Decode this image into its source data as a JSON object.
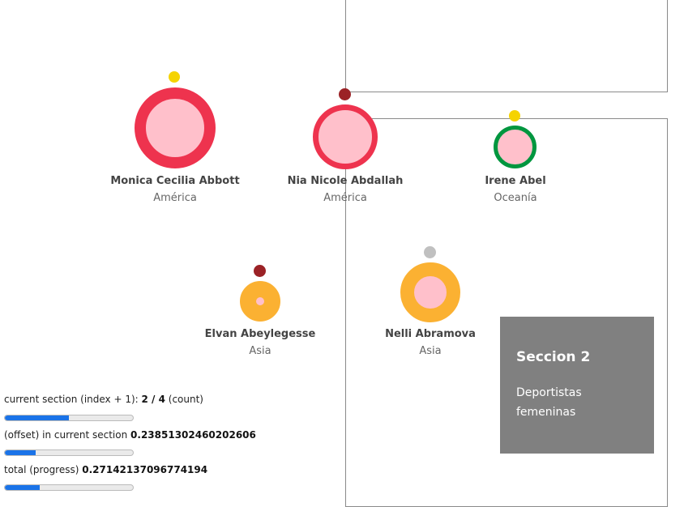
{
  "colors": {
    "america_ring": "#ee334e",
    "oceania_ring": "#00963f",
    "asia_ring": "#fbb132",
    "inner": "#ffc0cb",
    "medal_gold": "#f5d300",
    "medal_dark_red": "#9b2226",
    "medal_silver": "#c0c0c0",
    "panel_bg": "#808080",
    "progress_fill": "#1a73e8"
  },
  "athletes": [
    {
      "name": "Monica Cecilia Abbott",
      "region": "América",
      "medal_color": "gold"
    },
    {
      "name": "Nia Nicole Abdallah",
      "region": "América",
      "medal_color": "dark-red"
    },
    {
      "name": "Irene Abel",
      "region": "Oceanía",
      "medal_color": "gold"
    },
    {
      "name": "Elvan Abeylegesse",
      "region": "Asia",
      "medal_color": "dark-red"
    },
    {
      "name": "Nelli Abramova",
      "region": "Asia",
      "medal_color": "silver"
    }
  ],
  "panel": {
    "title": "Seccion 2",
    "text": "Deportistas femeninas"
  },
  "progress": {
    "section_prefix": "current section (index + 1): ",
    "section_value": "2 / 4",
    "section_suffix": " (count)",
    "section_fraction": 0.5,
    "offset_prefix": "(offset) in current section ",
    "offset_value": "0.23851302460202606",
    "offset_fraction": 0.23851302460202606,
    "total_prefix": "total (progress) ",
    "total_value": "0.27142137096774194",
    "total_fraction": 0.27142137096774194
  }
}
